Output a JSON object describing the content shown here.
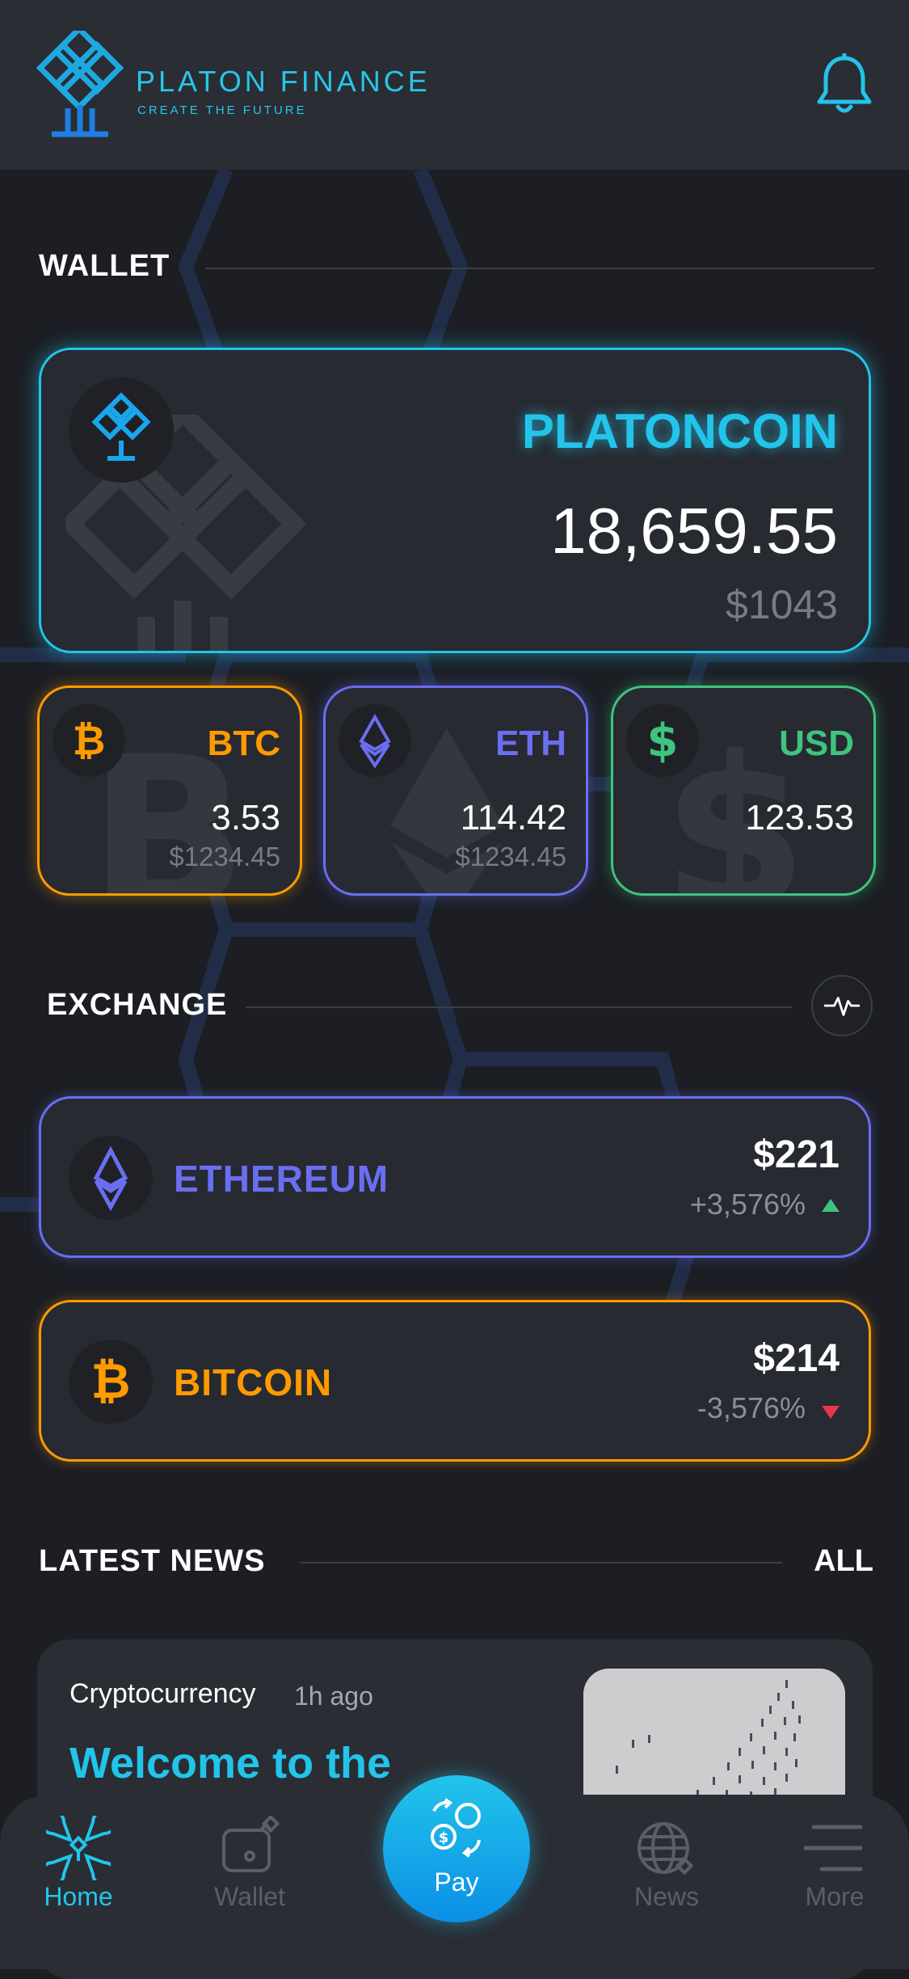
{
  "header": {
    "brand_name": "PLATON FINANCE",
    "brand_tagline": "CREATE THE FUTURE",
    "icon": "bell-icon"
  },
  "wallet": {
    "title": "WALLET",
    "main": {
      "name": "PLATONCOIN",
      "amount": "18,659.55",
      "usd": "$1043",
      "icon": "platoncoin-icon"
    },
    "cards": [
      {
        "ticker": "BTC",
        "amount": "3.53",
        "usd": "$1234.45",
        "icon": "bitcoin-icon",
        "color": "#ff9a00"
      },
      {
        "ticker": "ETH",
        "amount": "114.42",
        "usd": "$1234.45",
        "icon": "ethereum-icon",
        "color": "#6a6ef0"
      },
      {
        "ticker": "USD",
        "amount": "123.53",
        "usd": "",
        "icon": "dollar-icon",
        "color": "#3ec47e"
      }
    ]
  },
  "exchange": {
    "title": "EXCHANGE",
    "icon": "pulse-icon",
    "rows": [
      {
        "name": "ETHEREUM",
        "price": "$221",
        "change": "+3,576%",
        "direction": "up",
        "color": "#6a6ef0",
        "up_color": "#3ec47e"
      },
      {
        "name": "BITCOIN",
        "price": "$214",
        "change": "-3,576%",
        "direction": "down",
        "color": "#ff9a00",
        "down_color": "#e8364f"
      }
    ]
  },
  "news": {
    "title": "LATEST NEWS",
    "all_label": "ALL",
    "items": [
      {
        "category": "Cryptocurrency",
        "time": "1h ago",
        "headline": "Welcome to the"
      }
    ]
  },
  "nav": {
    "items": [
      {
        "label": "Home",
        "icon": "home-icon",
        "active": true
      },
      {
        "label": "Wallet",
        "icon": "wallet-icon",
        "active": false
      },
      {
        "label": "Pay",
        "icon": "pay-icon",
        "active": false
      },
      {
        "label": "News",
        "icon": "globe-icon",
        "active": false
      },
      {
        "label": "More",
        "icon": "menu-icon",
        "active": false
      }
    ],
    "active_color": "#22c4ea"
  }
}
